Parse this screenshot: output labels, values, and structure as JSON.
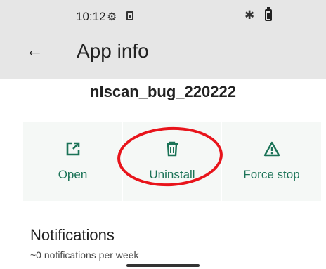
{
  "status_bar": {
    "time": "10:12",
    "icons": [
      "gear-icon",
      "sim-card-icon",
      "bluetooth-icon",
      "battery-icon"
    ],
    "battery_level": 0.7
  },
  "header": {
    "back_icon": "arrow-left-icon",
    "title": "App info"
  },
  "app": {
    "name": "nlscan_bug_220222"
  },
  "actions": [
    {
      "label": "Open",
      "icon": "open-external-icon"
    },
    {
      "label": "Uninstall",
      "icon": "trash-icon"
    },
    {
      "label": "Force stop",
      "icon": "warning-icon"
    }
  ],
  "notifications": {
    "title": "Notifications",
    "subtitle": "~0 notifications per week"
  },
  "colors": {
    "accent": "#1b7357",
    "header_bg": "#e6e6e6",
    "action_bg": "#f5f8f6",
    "annotation": "#e8141b"
  }
}
